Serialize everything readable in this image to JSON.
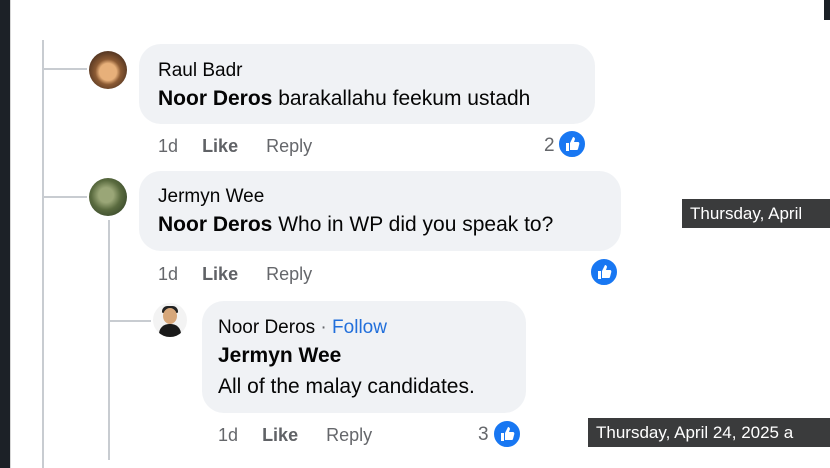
{
  "comments": [
    {
      "author": "Raul Badr",
      "mention": "Noor Deros",
      "text": " barakallahu feekum ustadh",
      "time": "1d",
      "like_label": "Like",
      "reply_label": "Reply",
      "reactions": "2"
    },
    {
      "author": "Jermyn Wee",
      "mention": "Noor Deros",
      "text": " Who in WP did you speak to?",
      "time": "1d",
      "like_label": "Like",
      "reply_label": "Reply",
      "tooltip": "Thursday, April"
    }
  ],
  "reply": {
    "author": "Noor Deros",
    "separator": " · ",
    "follow_label": "Follow",
    "mention": "Jermyn Wee",
    "text": "All of the malay candidates.",
    "time": "1d",
    "like_label": "Like",
    "reply_label": "Reply",
    "reactions": "3",
    "tooltip": "Thursday, April 24, 2025 a"
  },
  "colors": {
    "bubble": "#f0f2f5",
    "like_blue": "#1877f2",
    "follow_blue": "#216fdb",
    "meta_gray": "#65676b",
    "tooltip_bg": "#3a3b3c"
  },
  "icons": [
    "thumbs-up-icon",
    "avatar-photo"
  ]
}
